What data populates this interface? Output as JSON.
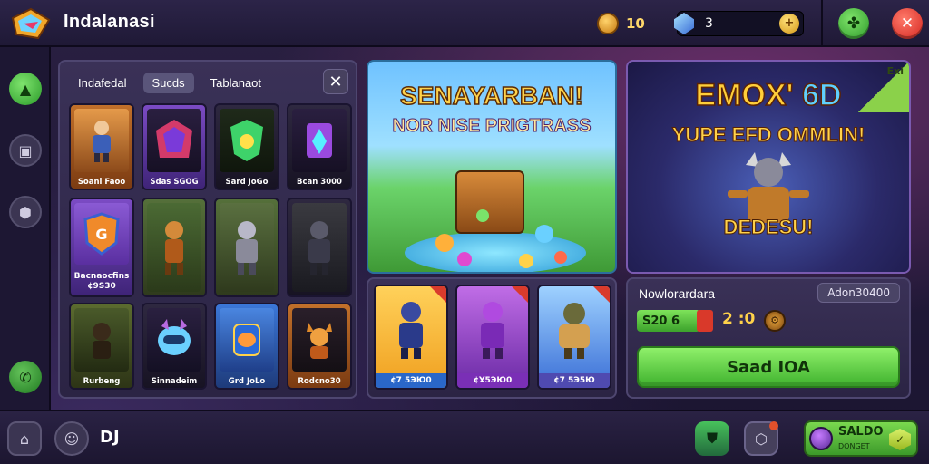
{
  "header": {
    "title": "Indalanasi",
    "gold": "10",
    "gems": "3"
  },
  "inventory": {
    "tabs": [
      "Indafedal",
      "Sucds",
      "Tablanaot"
    ],
    "items": [
      {
        "label": "Soanl Faoo"
      },
      {
        "label": "Sdas SGOG"
      },
      {
        "label": "Sard JoGo"
      },
      {
        "label": "Bcan 3000"
      },
      {
        "label": "Bacnaocfins ¢9S30"
      },
      {
        "label": ""
      },
      {
        "label": ""
      },
      {
        "label": ""
      },
      {
        "label": "Rurbeng"
      },
      {
        "label": "Sinnadeim"
      },
      {
        "label": "Grd JoLo"
      },
      {
        "label": "Rodcno30"
      }
    ]
  },
  "banner1": {
    "title": "SENAYARBAN!",
    "subtitle": "NOR NISE PRIGTRASS"
  },
  "heroes": [
    {
      "price": "¢7 5ЭЮ0"
    },
    {
      "price": "¢Ұ5ЭЮ0"
    },
    {
      "price": "¢7 5Э5Ю"
    }
  ],
  "banner2": {
    "title_a": "EMOX'",
    "title_b": "6D",
    "subtitle": "YUPE EFD OMMLIN!",
    "cta_text": "DEDESU!",
    "badge": "Exi"
  },
  "purchase": {
    "label": "Nowlorardara",
    "code": "Adon30400",
    "price": "S20 6",
    "amount": "2 :0",
    "button_label": "Saad IOA"
  },
  "footer": {
    "count": "DJ",
    "saldo_title": "SALDO",
    "saldo_sub": "DONGET"
  }
}
